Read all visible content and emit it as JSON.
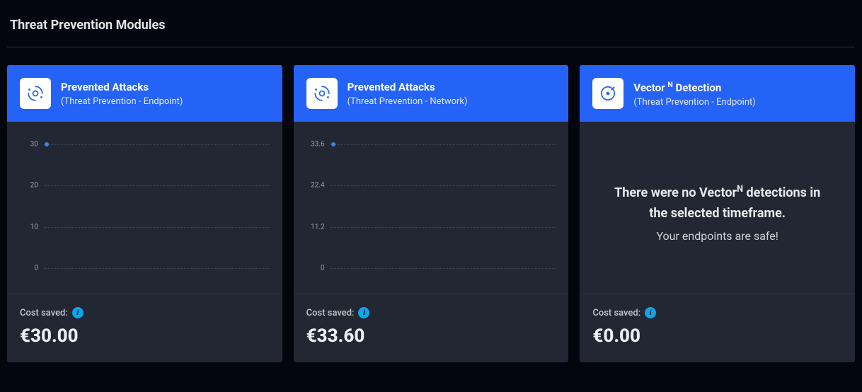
{
  "section_title": "Threat Prevention Modules",
  "cards": [
    {
      "title": "Prevented Attacks",
      "subtitle": "(Threat Prevention - Endpoint)",
      "cost_label": "Cost saved:",
      "cost_value": "€30.00"
    },
    {
      "title": "Prevented Attacks",
      "subtitle": "(Threat Prevention - Network)",
      "cost_label": "Cost saved:",
      "cost_value": "€33.60"
    },
    {
      "title_html": "Vector <sup>N</sup> Detection",
      "title_plain": "Vector N Detection",
      "subtitle": "(Threat Prevention - Endpoint)",
      "empty_line1_html": "There were no Vector<sup>N</sup> detections in the selected timeframe.",
      "empty_line1_plain": "There were no VectorN detections in the selected timeframe.",
      "empty_line2": "Your endpoints are safe!",
      "cost_label": "Cost saved:",
      "cost_value": "€0.00"
    }
  ],
  "chart_data": [
    {
      "type": "line",
      "y_ticks": [
        "30",
        "20",
        "10",
        "0"
      ],
      "ylim": [
        0,
        30
      ],
      "series": [
        {
          "name": "Prevented Attacks",
          "values": [
            30
          ]
        }
      ]
    },
    {
      "type": "line",
      "y_ticks": [
        "33.6",
        "22.4",
        "11.2",
        "0"
      ],
      "ylim": [
        0,
        33.6
      ],
      "series": [
        {
          "name": "Prevented Attacks",
          "values": [
            33.6
          ]
        }
      ]
    }
  ],
  "info_glyph": "i"
}
